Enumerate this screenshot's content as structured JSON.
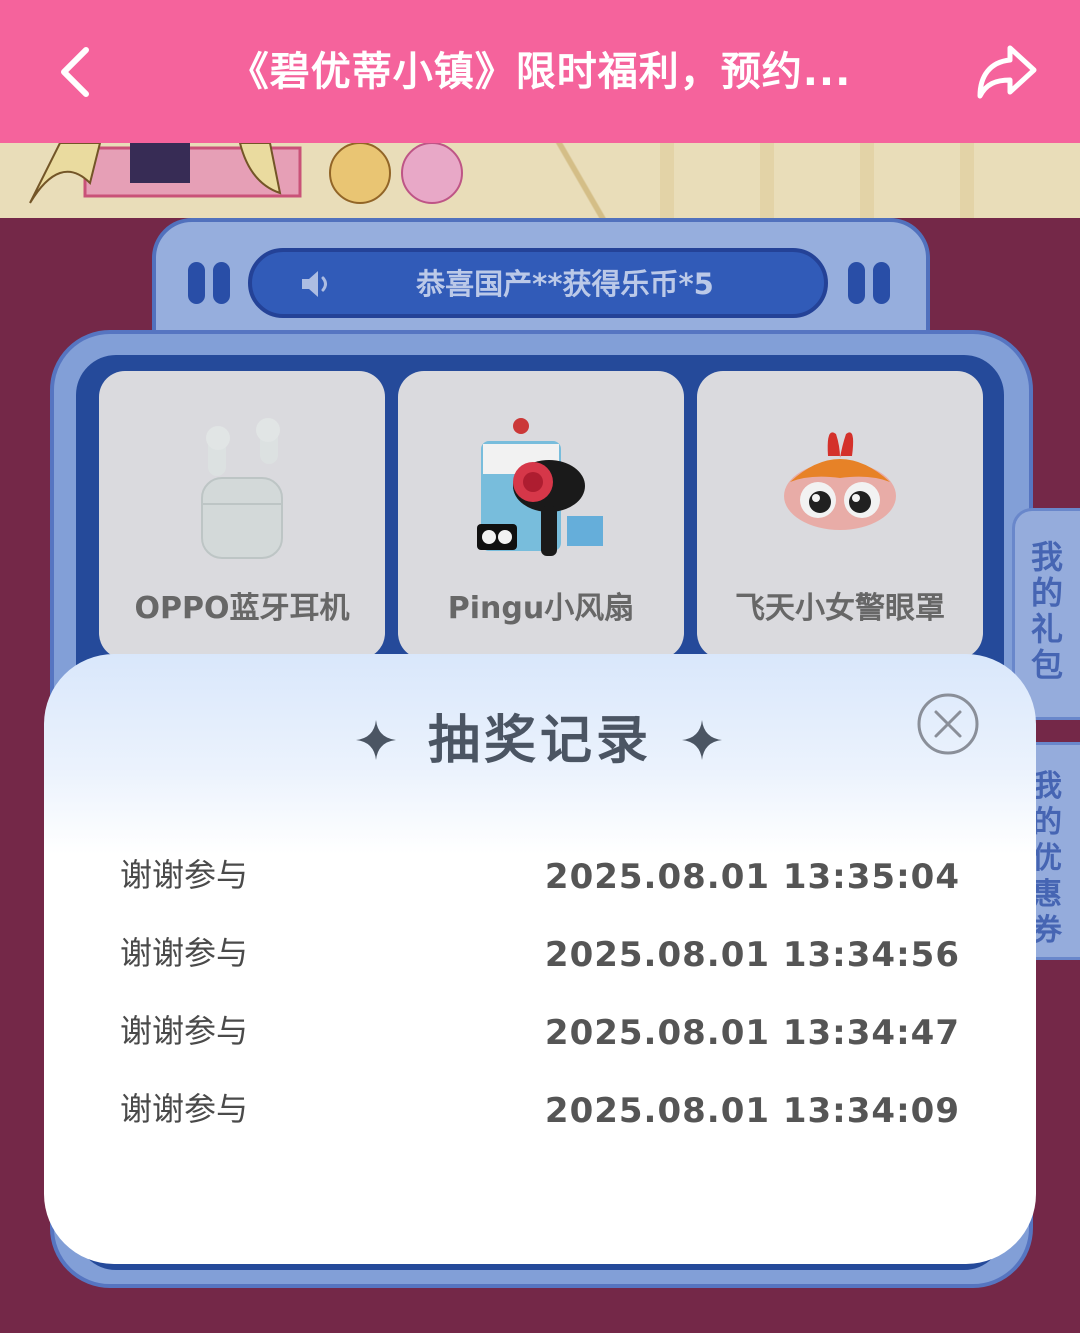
{
  "navbar": {
    "title": "《碧优蒂小镇》限时福利，预约...",
    "back_icon": "chevron-left-icon",
    "share_icon": "share-arrow-icon",
    "background": "#f5639c"
  },
  "game": {
    "ticker_text": "恭喜国产**获得乐币*5",
    "ticker_icon": "speaker-icon",
    "prizes": [
      {
        "label": "OPPO蓝牙耳机",
        "icon": "earbuds-icon"
      },
      {
        "label": "Pingu小风扇",
        "icon": "fan-icon"
      },
      {
        "label": "飞天小女警眼罩",
        "icon": "eye-mask-icon"
      }
    ],
    "side_tabs": {
      "gift_bag": "我的礼包",
      "coupons": "我的优惠券"
    }
  },
  "modal": {
    "title": "抽奖记录",
    "close_icon": "close-circle-icon",
    "records": [
      {
        "result": "谢谢参与",
        "time": "2025.08.01 13:35:04"
      },
      {
        "result": "谢谢参与",
        "time": "2025.08.01 13:34:56"
      },
      {
        "result": "谢谢参与",
        "time": "2025.08.01 13:34:47"
      },
      {
        "result": "谢谢参与",
        "time": "2025.08.01 13:34:09"
      }
    ]
  }
}
